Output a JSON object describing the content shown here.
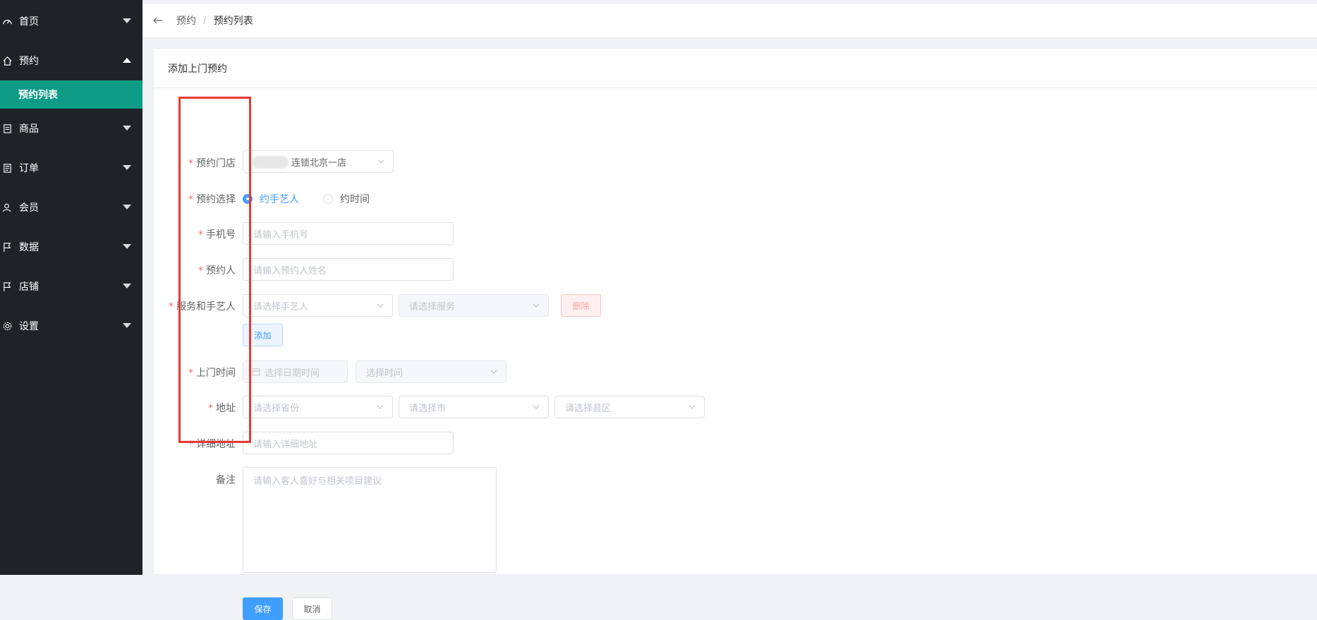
{
  "sidebar": {
    "items": [
      {
        "label": "首页",
        "icon": "dashboard-icon",
        "expanded": false
      },
      {
        "label": "预约",
        "icon": "home-icon",
        "expanded": true
      },
      {
        "label": "商品",
        "icon": "document-icon",
        "expanded": false
      },
      {
        "label": "订单",
        "icon": "clipboard-icon",
        "expanded": false
      },
      {
        "label": "会员",
        "icon": "user-icon",
        "expanded": false
      },
      {
        "label": "数据",
        "icon": "flag-icon",
        "expanded": false
      },
      {
        "label": "店铺",
        "icon": "flag-icon",
        "expanded": false
      },
      {
        "label": "设置",
        "icon": "gear-icon",
        "expanded": false
      }
    ],
    "submenu_active": "预约列表"
  },
  "breadcrumb": {
    "items": [
      "预约",
      "预约列表"
    ],
    "separator": "/"
  },
  "card": {
    "title": "添加上门预约"
  },
  "form": {
    "store": {
      "label": "预约门店",
      "value": "连锁北京一店"
    },
    "booking_choice": {
      "label": "预约选择",
      "options": [
        "约手艺人",
        "约时间"
      ],
      "selected": "约手艺人"
    },
    "phone": {
      "label": "手机号",
      "placeholder": "请输入手机号"
    },
    "booker": {
      "label": "预约人",
      "placeholder": "请输入预约人姓名"
    },
    "service": {
      "label": "服务和手艺人",
      "artisan_placeholder": "请选择手艺人",
      "service_placeholder": "请选择服务",
      "delete_label": "删除",
      "add_label": "添加"
    },
    "visit_time": {
      "label": "上门时间",
      "date_placeholder": "选择日期时间",
      "time_placeholder": "选择时间"
    },
    "address": {
      "label": "地址",
      "province_placeholder": "请选择省份",
      "city_placeholder": "请选择市",
      "district_placeholder": "请选择县区"
    },
    "detail_address": {
      "label": "详细地址",
      "placeholder": "请输入详细地址"
    },
    "remark": {
      "label": "备注",
      "placeholder": "请输入客人喜好与相关项目建议"
    },
    "save_label": "保存",
    "cancel_label": "取消"
  },
  "colors": {
    "sidebar_bg": "#1f2329",
    "active_submenu": "#0e9c86",
    "primary": "#409eff",
    "required": "#f56c6c",
    "highlight_box": "#e53935"
  }
}
